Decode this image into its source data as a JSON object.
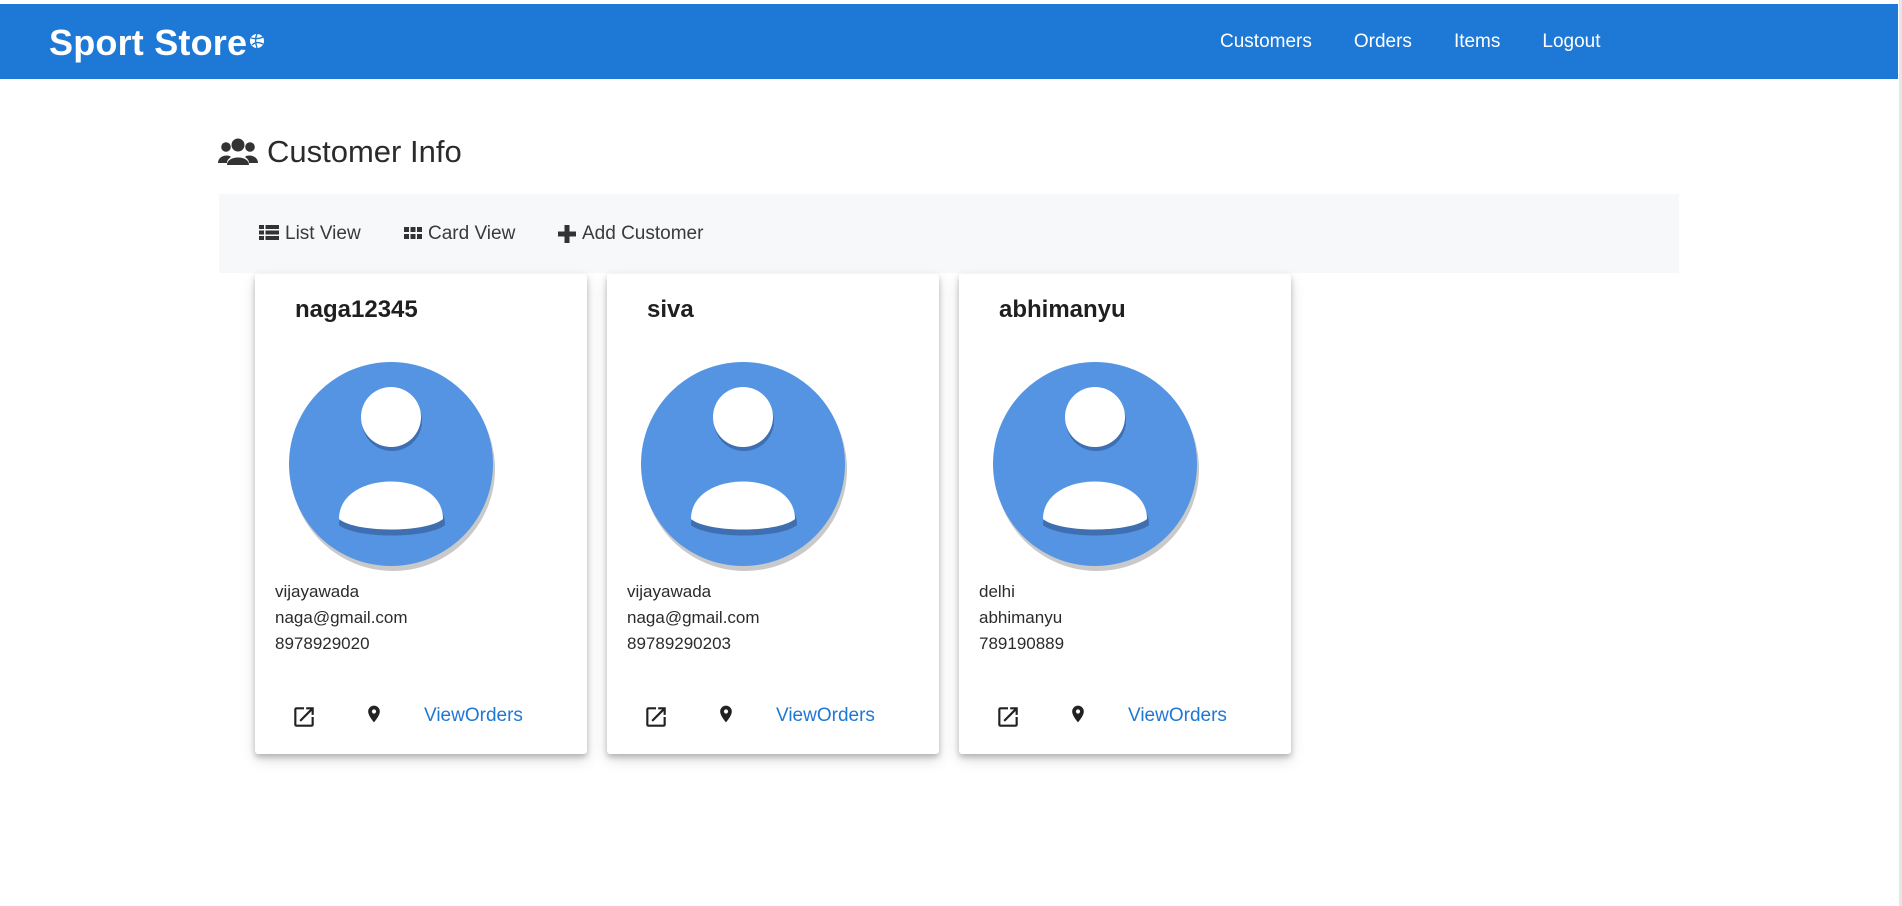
{
  "colors": {
    "brand_blue": "#1e78d6",
    "avatar_blue": "#5594e2",
    "toolbar_bg": "#f7f8f9"
  },
  "navbar": {
    "brand": "Sport Store",
    "brand_icon": "volleyball-icon",
    "links": [
      "Customers",
      "Orders",
      "Items",
      "Logout"
    ]
  },
  "page": {
    "title": "Customer Info",
    "title_icon": "users-icon"
  },
  "toolbar": {
    "list_view": "List View",
    "card_view": "Card View",
    "add_customer": "Add Customer"
  },
  "customers": [
    {
      "name": "naga12345",
      "city": "vijayawada",
      "email": "naga@gmail.com",
      "phone": "8978929020",
      "orders_label": "ViewOrders"
    },
    {
      "name": "siva",
      "city": "vijayawada",
      "email": "naga@gmail.com",
      "phone": "89789290203",
      "orders_label": "ViewOrders"
    },
    {
      "name": "abhimanyu",
      "city": "delhi",
      "email": "abhimanyu",
      "phone": "789190889",
      "orders_label": "ViewOrders"
    }
  ]
}
